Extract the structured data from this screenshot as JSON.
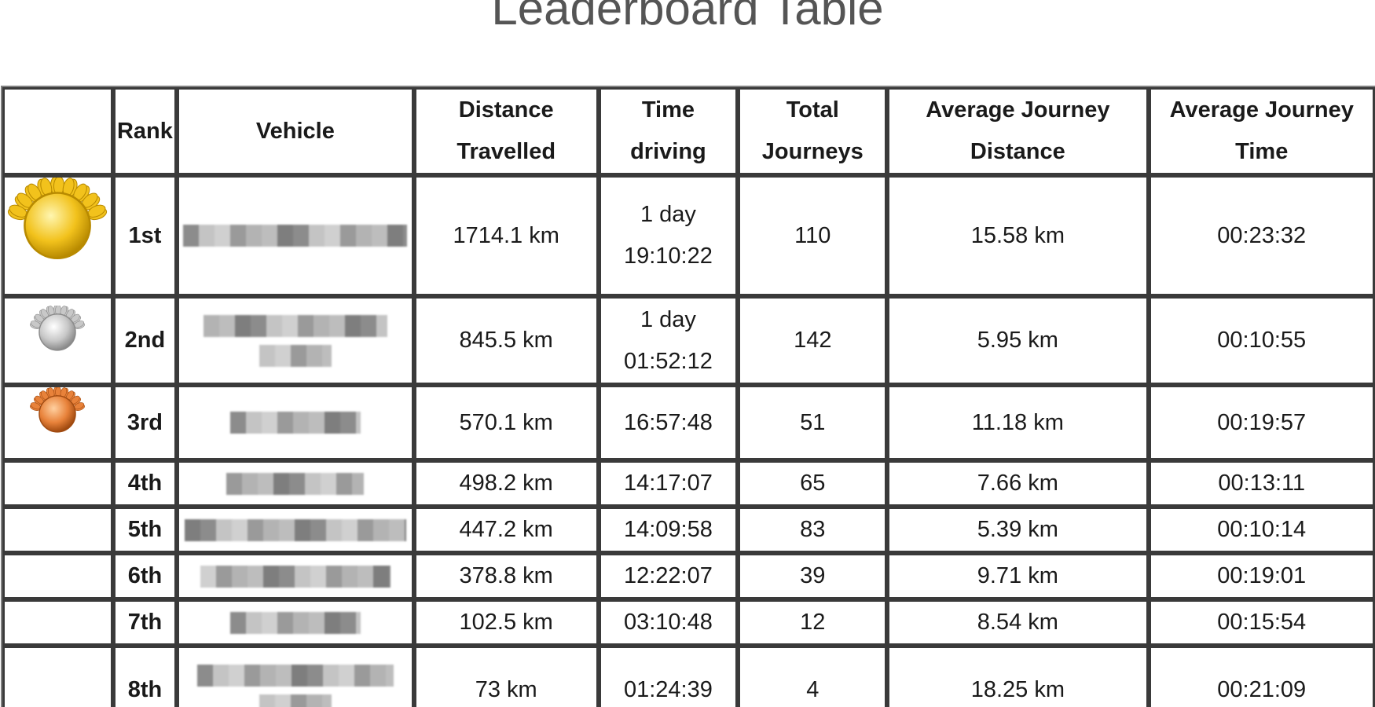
{
  "title": "Leaderboard Table",
  "columns": [
    "",
    "Rank",
    "Vehicle",
    "Distance Travelled",
    "Time driving",
    "Total Journeys",
    "Average Journey Distance",
    "Average Journey Time"
  ],
  "rows": [
    {
      "medal": "gold-medal",
      "rank": "1st",
      "vehicle_redacted": true,
      "distance": "1714.1 km",
      "time": "1 day 19:10:22",
      "journeys": "110",
      "avg_distance": "15.58 km",
      "avg_time": "00:23:32"
    },
    {
      "medal": "silver-medal",
      "rank": "2nd",
      "vehicle_redacted": true,
      "distance": "845.5 km",
      "time": "1 day 01:52:12",
      "journeys": "142",
      "avg_distance": "5.95 km",
      "avg_time": "00:10:55"
    },
    {
      "medal": "bronze-medal",
      "rank": "3rd",
      "vehicle_redacted": true,
      "distance": "570.1 km",
      "time": "16:57:48",
      "journeys": "51",
      "avg_distance": "11.18 km",
      "avg_time": "00:19:57"
    },
    {
      "medal": "",
      "rank": "4th",
      "vehicle_redacted": true,
      "distance": "498.2 km",
      "time": "14:17:07",
      "journeys": "65",
      "avg_distance": "7.66 km",
      "avg_time": "00:13:11"
    },
    {
      "medal": "",
      "rank": "5th",
      "vehicle_redacted": true,
      "distance": "447.2 km",
      "time": "14:09:58",
      "journeys": "83",
      "avg_distance": "5.39 km",
      "avg_time": "00:10:14"
    },
    {
      "medal": "",
      "rank": "6th",
      "vehicle_redacted": true,
      "distance": "378.8 km",
      "time": "12:22:07",
      "journeys": "39",
      "avg_distance": "9.71 km",
      "avg_time": "00:19:01"
    },
    {
      "medal": "",
      "rank": "7th",
      "vehicle_redacted": true,
      "distance": "102.5 km",
      "time": "03:10:48",
      "journeys": "12",
      "avg_distance": "8.54 km",
      "avg_time": "00:15:54"
    },
    {
      "medal": "",
      "rank": "8th",
      "vehicle_redacted": true,
      "distance": "73 km",
      "time": "01:24:39",
      "journeys": "4",
      "avg_distance": "18.25 km",
      "avg_time": "00:21:09"
    }
  ],
  "colors": {
    "title": "#555555",
    "grid": "#3a3a3a",
    "gold": "#f2c21c",
    "silver": "#c8c8c8",
    "bronze": "#e8823a",
    "redaction": "#a0a0a0"
  }
}
